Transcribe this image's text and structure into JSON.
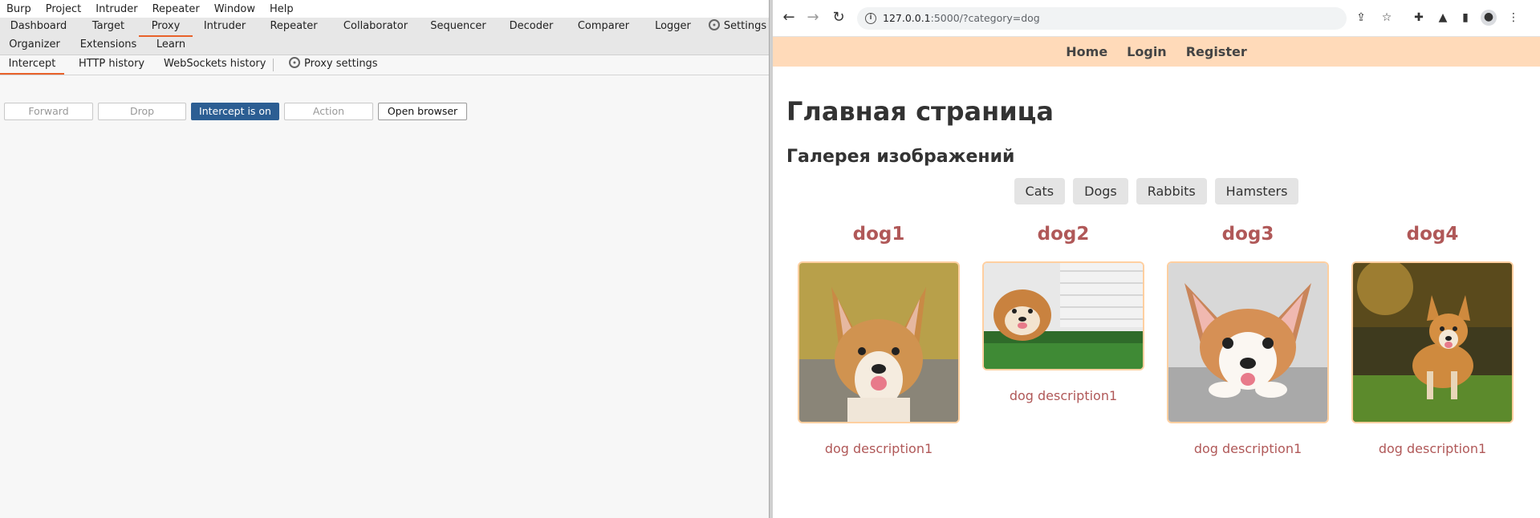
{
  "burp": {
    "menu": [
      "Burp",
      "Project",
      "Intruder",
      "Repeater",
      "Window",
      "Help"
    ],
    "main_tabs_row1": [
      "Dashboard",
      "Target",
      "Proxy",
      "Intruder",
      "Repeater",
      "Collaborator",
      "Sequencer",
      "Decoder",
      "Comparer",
      "Logger",
      "Settings"
    ],
    "main_tabs_row2": [
      "Organizer",
      "Extensions",
      "Learn"
    ],
    "active_main_tab": "Proxy",
    "sub_tabs": [
      "Intercept",
      "HTTP history",
      "WebSockets history"
    ],
    "proxy_settings_label": "Proxy settings",
    "active_sub_tab": "Intercept",
    "toolbar": {
      "forward": "Forward",
      "drop": "Drop",
      "intercept": "Intercept is on",
      "action": "Action",
      "open_browser": "Open browser"
    }
  },
  "browser": {
    "url_host": "127.0.0.1",
    "url_path": ":5000/?category=dog",
    "nav_links": [
      "Home",
      "Login",
      "Register"
    ],
    "page_title": "Главная страница",
    "gallery_title": "Галерея изображений",
    "filters": [
      "Cats",
      "Dogs",
      "Rabbits",
      "Hamsters"
    ],
    "cards": [
      {
        "title": "dog1",
        "description": "dog description1"
      },
      {
        "title": "dog2",
        "description": "dog description1"
      },
      {
        "title": "dog3",
        "description": "dog description1"
      },
      {
        "title": "dog4",
        "description": "dog description1"
      }
    ]
  },
  "colors": {
    "burp_accent": "#e8622a",
    "intercept_on": "#2c5e93",
    "site_nav_bg": "#ffdab9",
    "card_title": "#b05858",
    "image_border": "#ffcfa0"
  }
}
